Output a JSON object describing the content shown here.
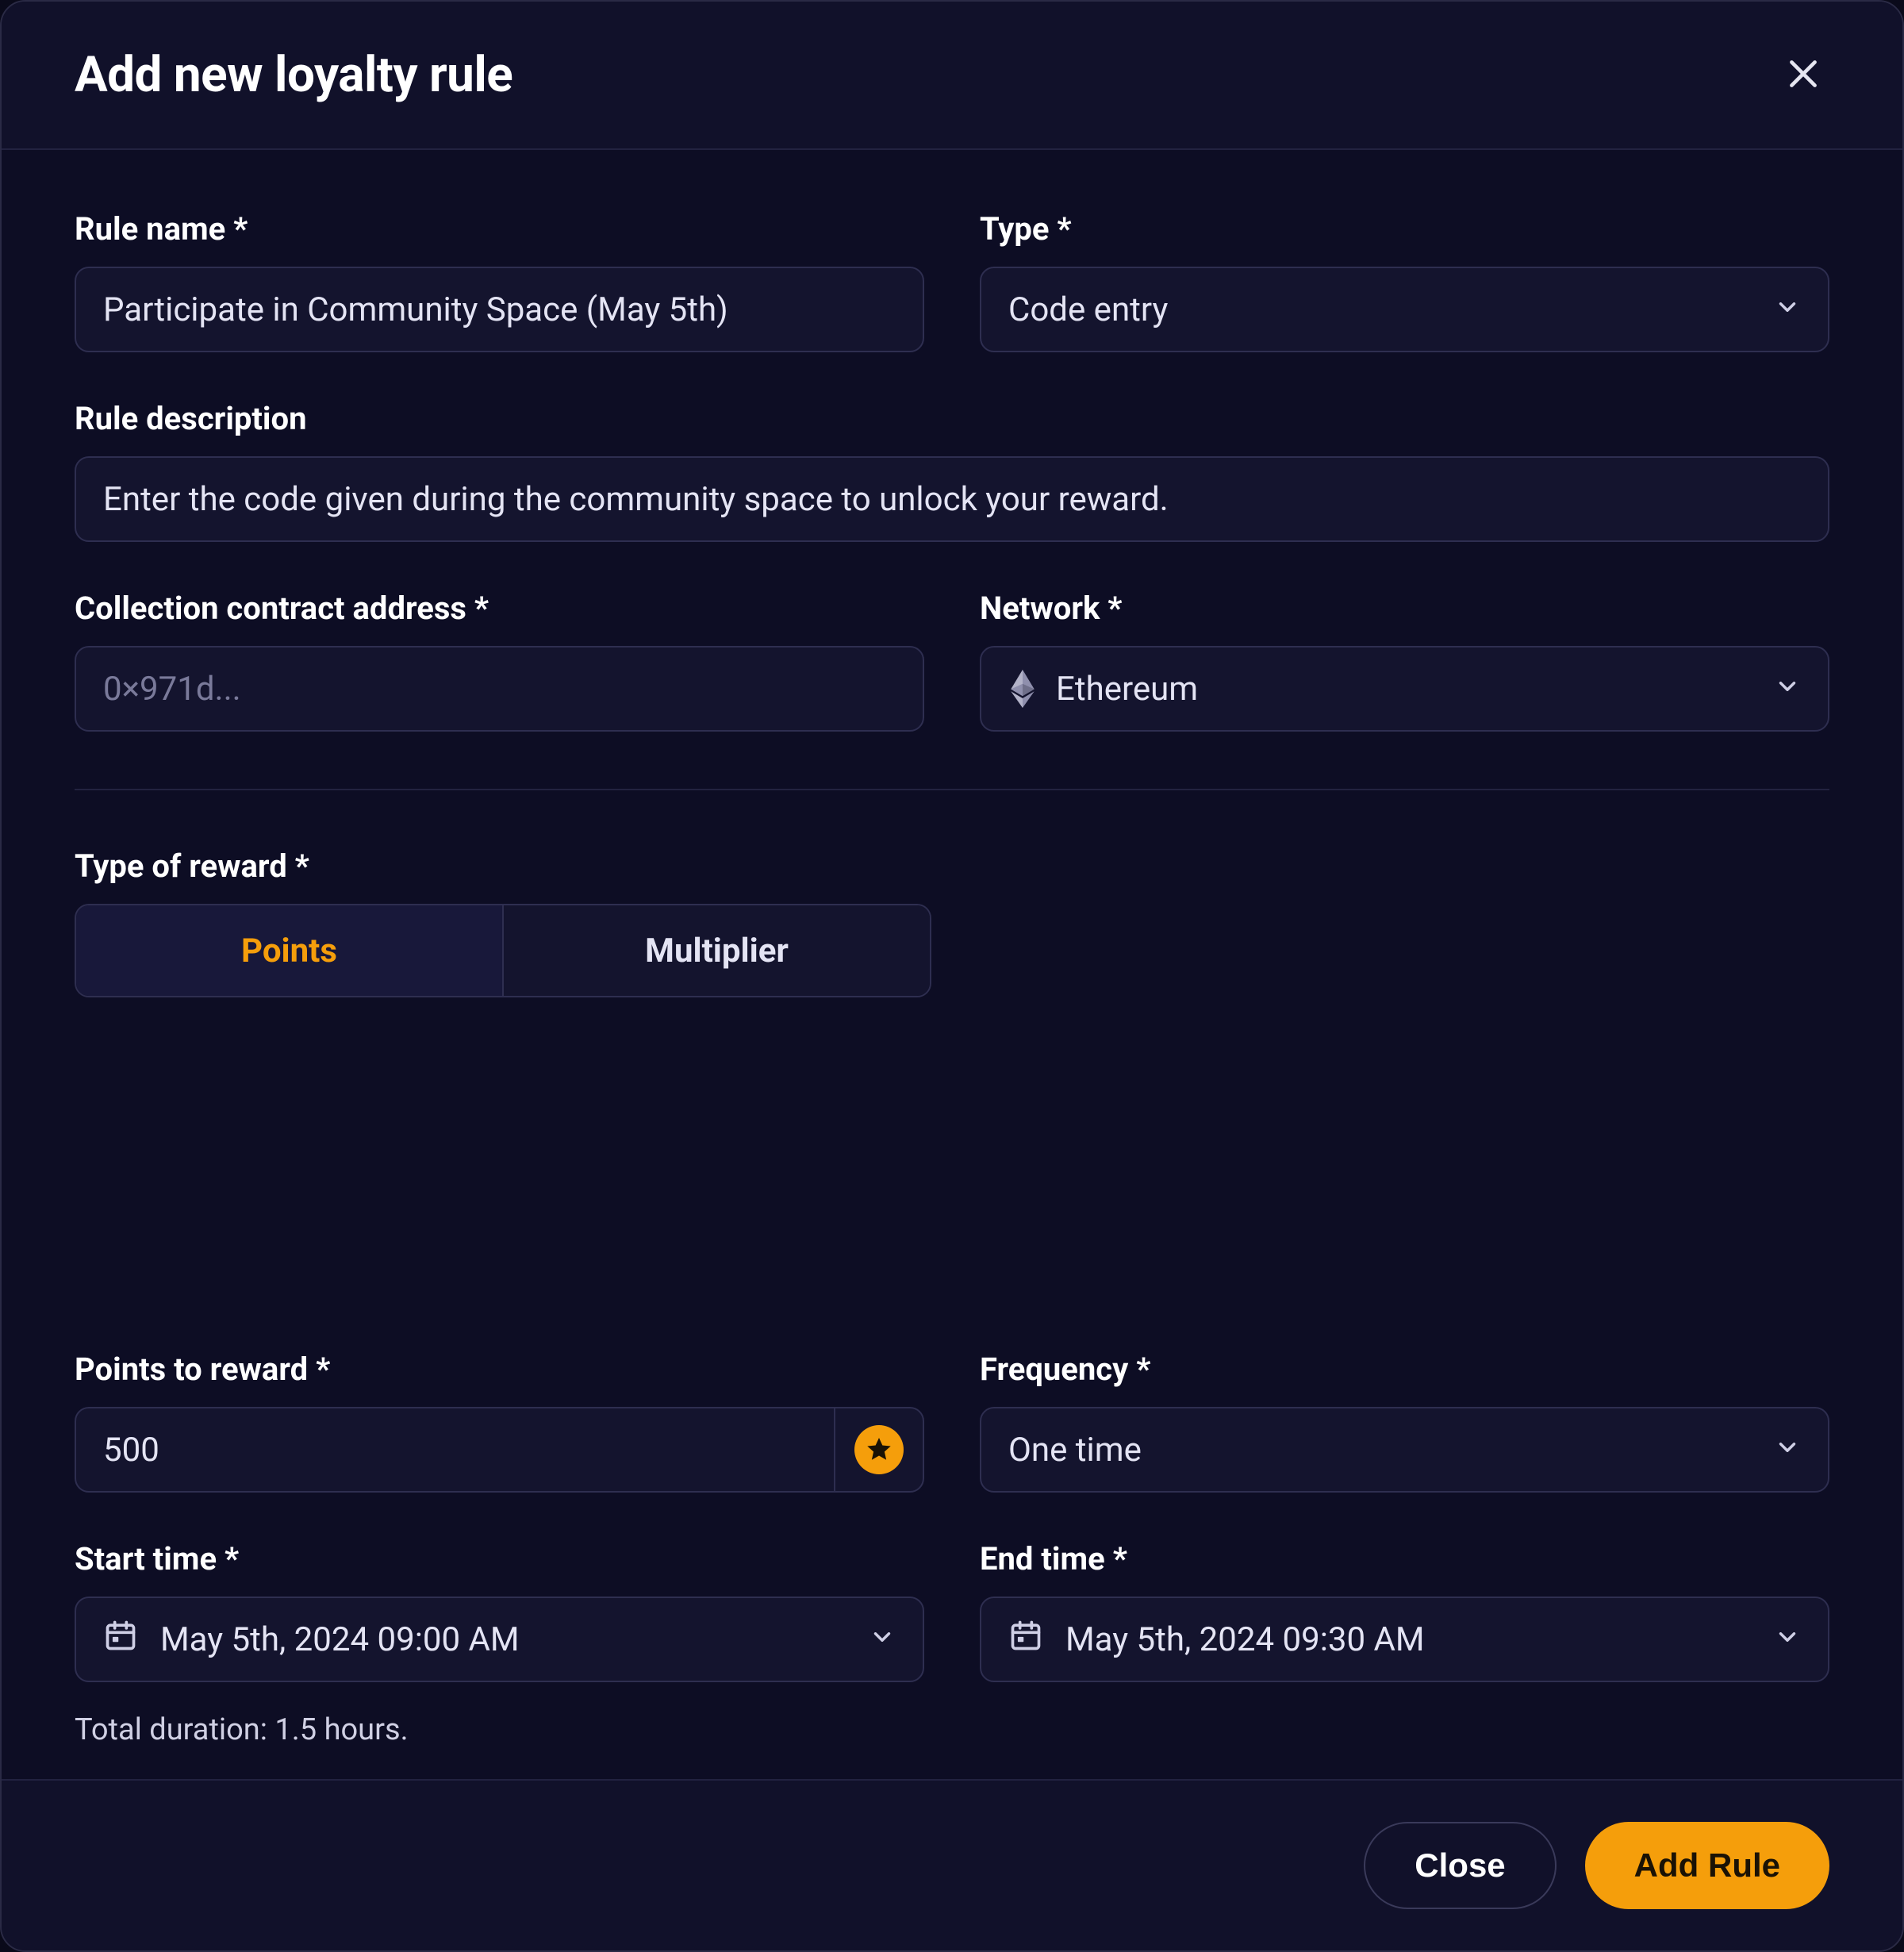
{
  "header": {
    "title": "Add new loyalty rule"
  },
  "labels": {
    "rule_name": "Rule name *",
    "type": "Type *",
    "rule_description": "Rule description",
    "contract_address": "Collection contract address *",
    "network": "Network *",
    "reward_type": "Type of reward *",
    "points_to_reward": "Points to reward *",
    "frequency": "Frequency *",
    "start_time": "Start time *",
    "end_time": "End time *"
  },
  "values": {
    "rule_name": "Participate in Community Space (May 5th)",
    "type": "Code entry",
    "rule_description": "Enter the code given during the community space to unlock your reward.",
    "contract_address_placeholder": "0×971d...",
    "network": "Ethereum",
    "reward_type_points": "Points",
    "reward_type_multiplier": "Multiplier",
    "points": "500",
    "frequency": "One time",
    "start_time": "May 5th, 2024 09:00 AM",
    "end_time": "May 5th, 2024 09:30 AM",
    "duration_note": "Total duration: 1.5 hours."
  },
  "footer": {
    "close": "Close",
    "add_rule": "Add Rule"
  }
}
